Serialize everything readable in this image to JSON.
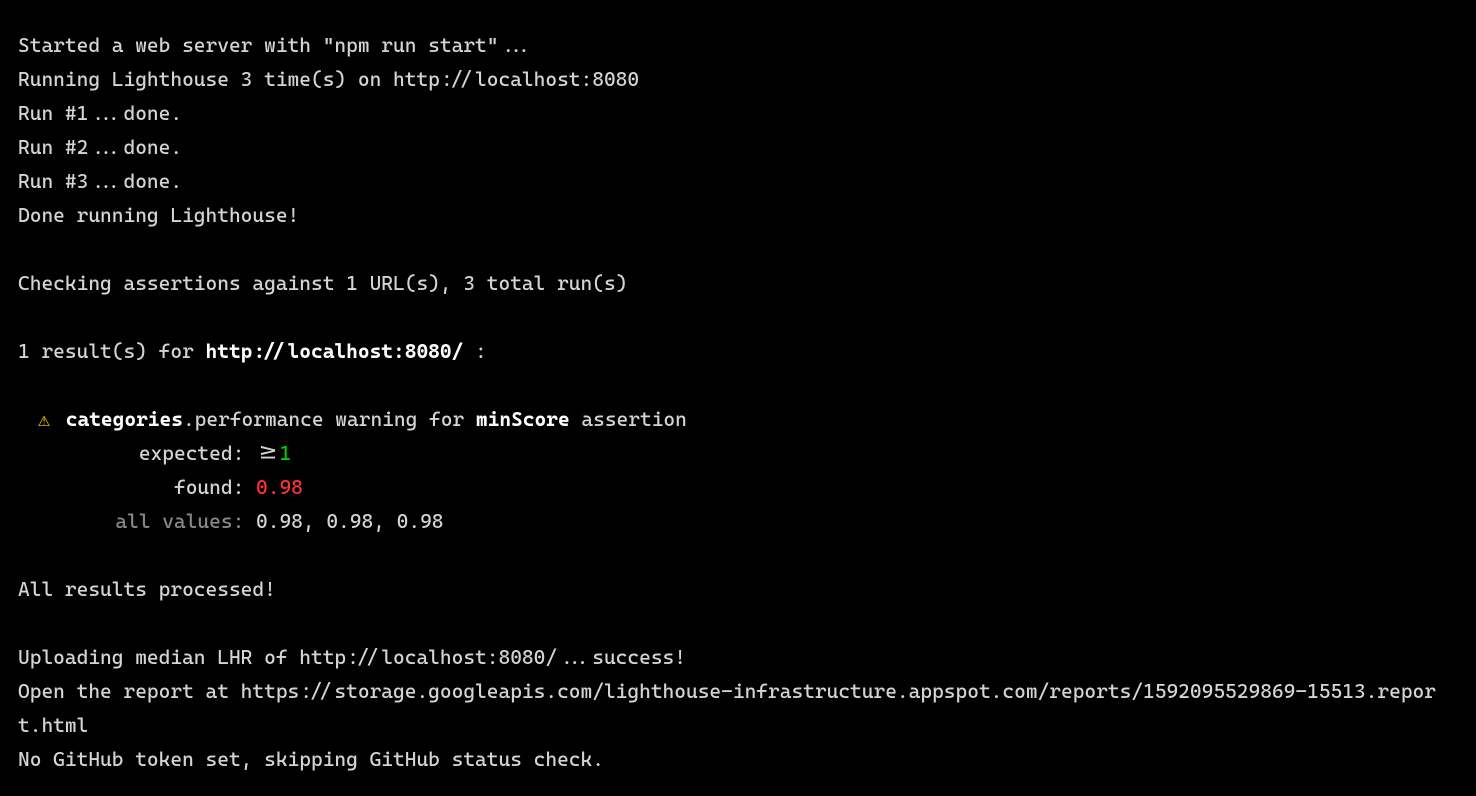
{
  "log": {
    "started": "Started a web server with \"npm run start\"...",
    "running": "Running Lighthouse 3 time(s) on http://localhost:8080",
    "run1": "Run #1...done.",
    "run2": "Run #2...done.",
    "run3": "Run #3...done.",
    "done_running": "Done running Lighthouse!",
    "checking": "Checking assertions against 1 URL(s), 3 total run(s)",
    "results_prefix": "1 result(s) for ",
    "results_url": "http://localhost:8080/",
    "results_suffix": " :",
    "assertion": {
      "icon": "⚠",
      "category_bold": "categories",
      "category_rest": ".performance warning for ",
      "metric": "minScore",
      "suffix": " assertion",
      "expected_label": "expected: ",
      "expected_operator": ">=",
      "expected_value": "1",
      "found_label": "found: ",
      "found_value": "0.98",
      "all_values_label": "all values: ",
      "all_values": "0.98, 0.98, 0.98"
    },
    "all_processed": "All results processed!",
    "uploading": "Uploading median LHR of http://localhost:8080/...success!",
    "open_report": "Open the report at https://storage.googleapis.com/lighthouse-infrastructure.appspot.com/reports/1592095529869-15513.report.html",
    "no_token": "No GitHub token set, skipping GitHub status check."
  }
}
